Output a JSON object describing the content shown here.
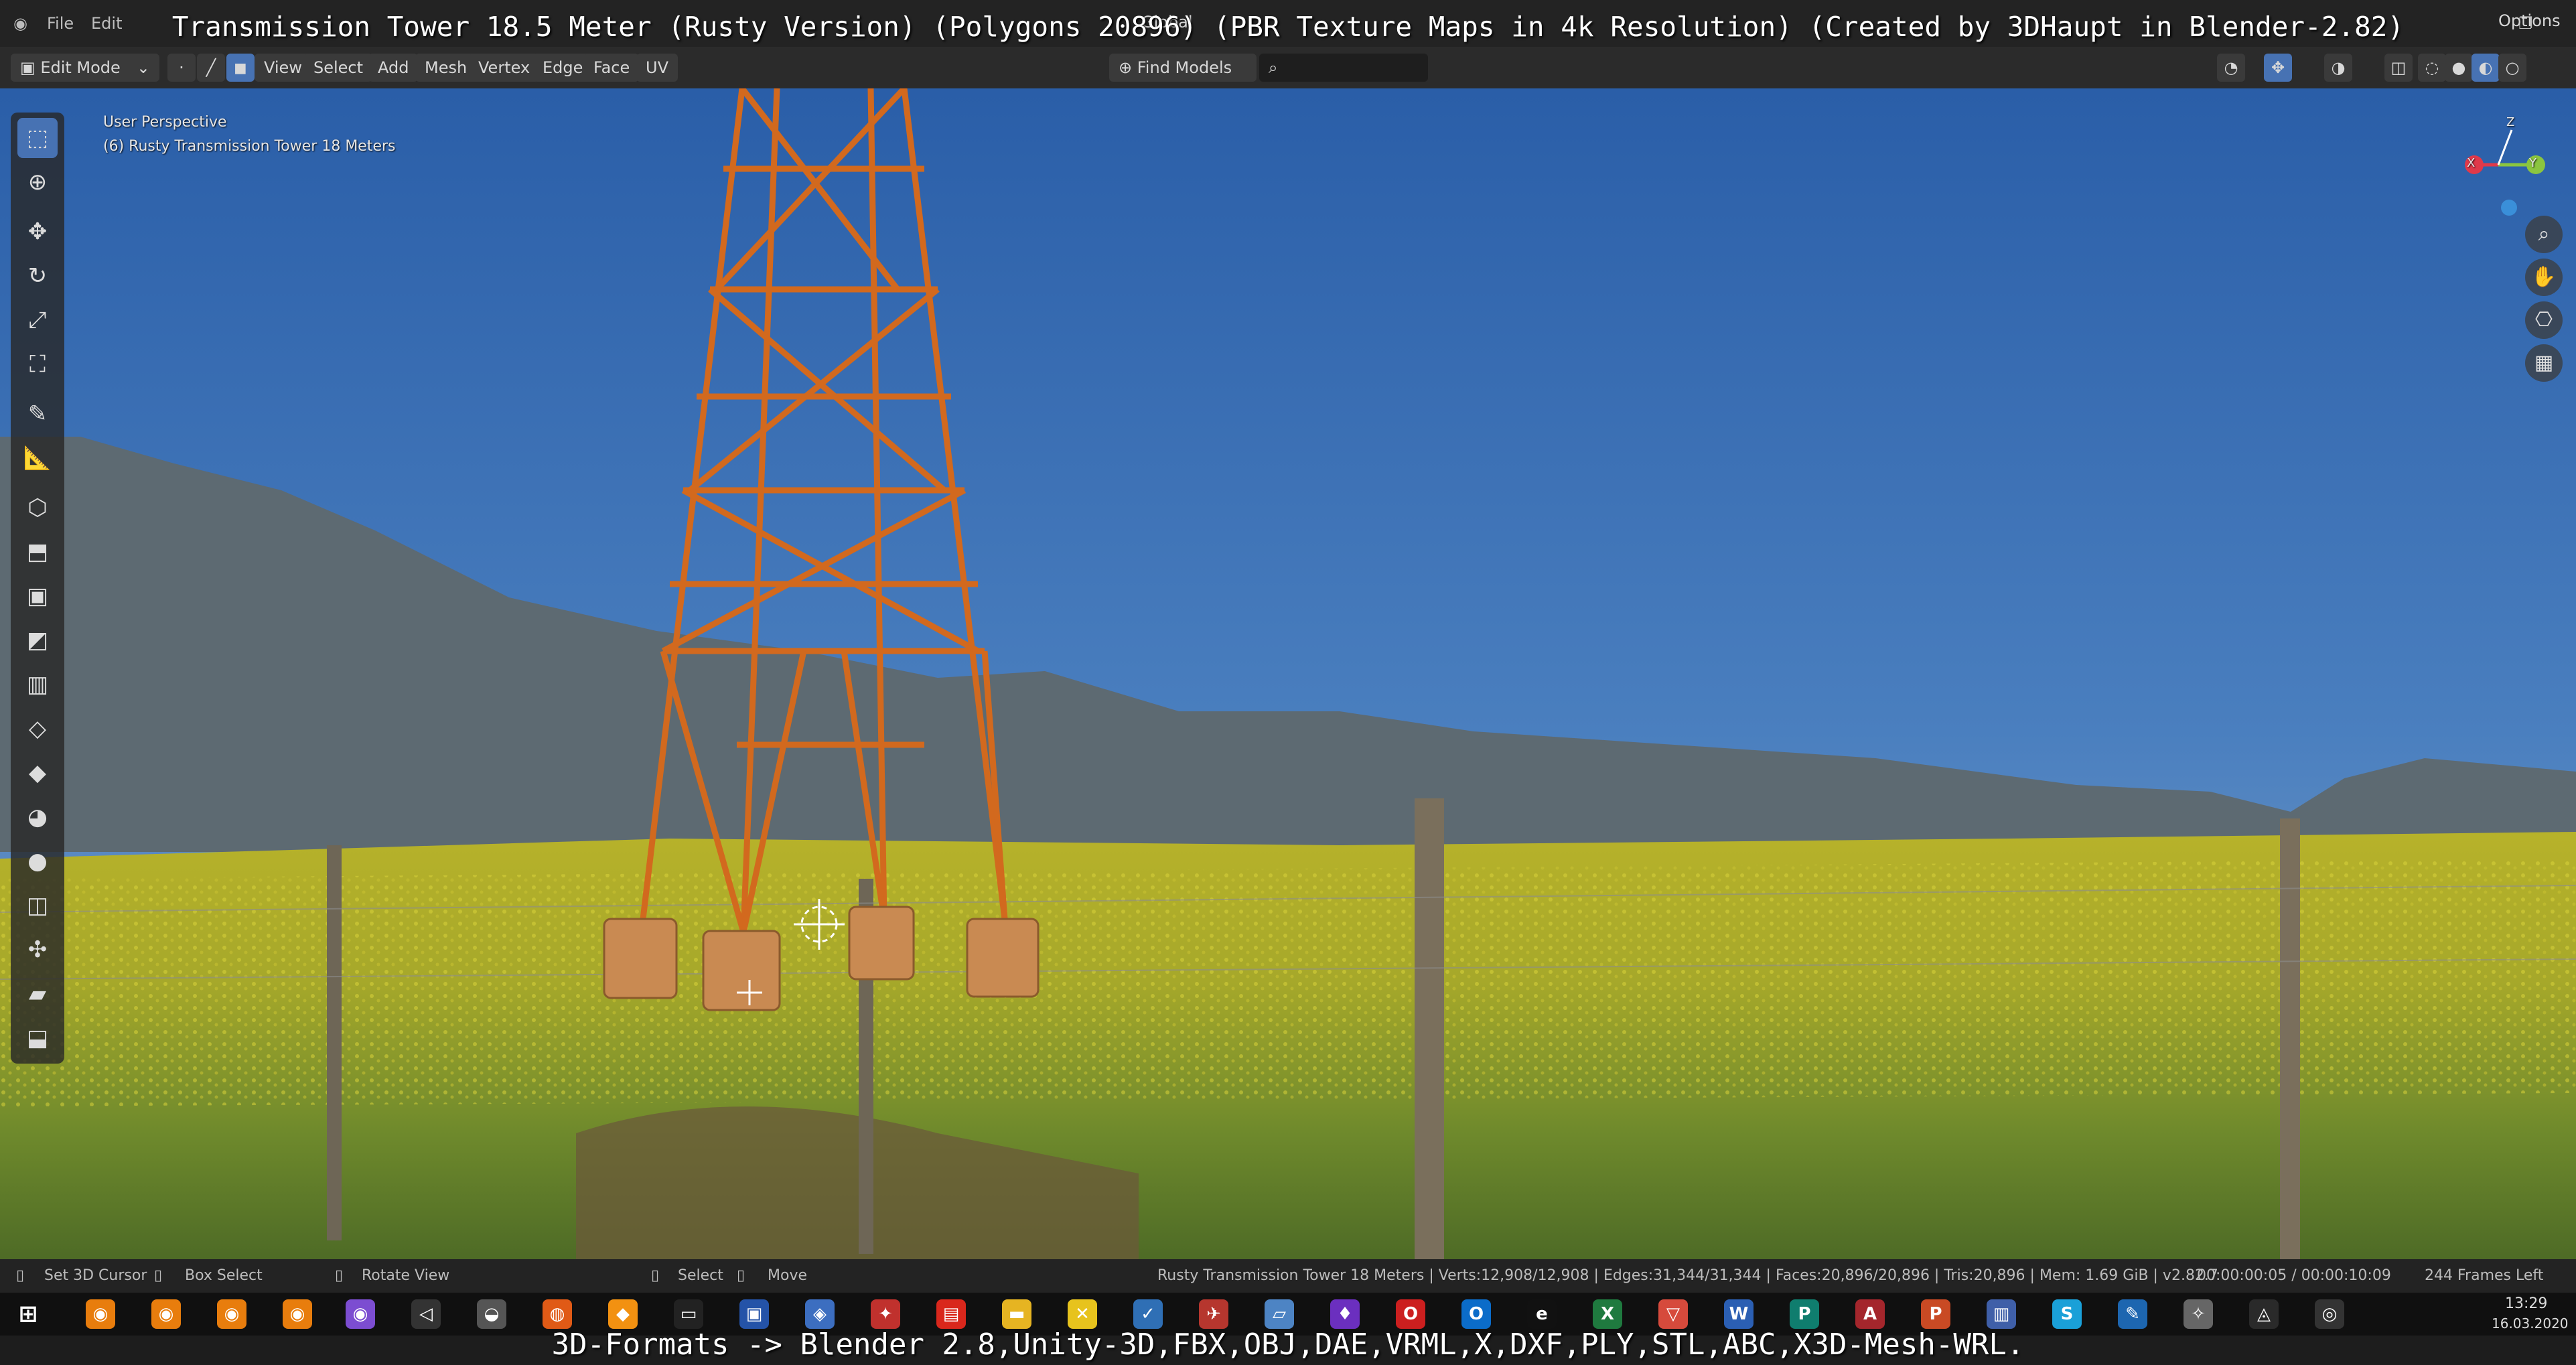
{
  "banner": {
    "title": "Transmission Tower 18.5 Meter (Rusty Version) (Polygons 20896) (PBR Texture Maps in 4k Resolution) (Created by 3DHaupt in Blender-2.82)"
  },
  "menu": {
    "file": "File",
    "edit": "Edit"
  },
  "header": {
    "mode": "Edit Mode",
    "view": "View",
    "select": "Select",
    "add": "Add",
    "mesh": "Mesh",
    "vertex": "Vertex",
    "edge": "Edge",
    "face": "Face",
    "uv": "UV",
    "transform_orientation": "Global",
    "find_models": "Find Models",
    "options": "Options"
  },
  "viewport": {
    "perspective_label": "User Perspective",
    "object_label": "(6) Rusty Transmission Tower 18 Meters",
    "gizmo": {
      "x": "X",
      "y": "Y",
      "z": "Z"
    }
  },
  "statusbar": {
    "set_cursor": "Set 3D Cursor",
    "box_select": "Box Select",
    "rotate_view": "Rotate View",
    "select": "Select",
    "move": "Move",
    "stats": "Rusty Transmission Tower 18 Meters | Verts:12,908/12,908 | Edges:31,344/31,344 | Faces:20,896/20,896 | Tris:20,896 | Mem: 1.69 GiB | v2.82.7",
    "time": "00:00:00:05 / 00:00:10:09",
    "frames_left": "244 Frames Left"
  },
  "taskbar": {
    "clock_time": "13:29",
    "clock_date": "16.03.2020"
  },
  "footer": {
    "formats": "3D-Formats -> Blender 2.8,Unity-3D,FBX,OBJ,DAE,VRML,X,DXF,PLY,STL,ABC,X3D-Mesh-WRL."
  },
  "colors": {
    "active_tool": "#4772b3",
    "tower": "#d2691e",
    "gizmo_x": "#e0394a",
    "gizmo_y": "#8bc53f",
    "gizmo_z": "#3a8fd9"
  }
}
